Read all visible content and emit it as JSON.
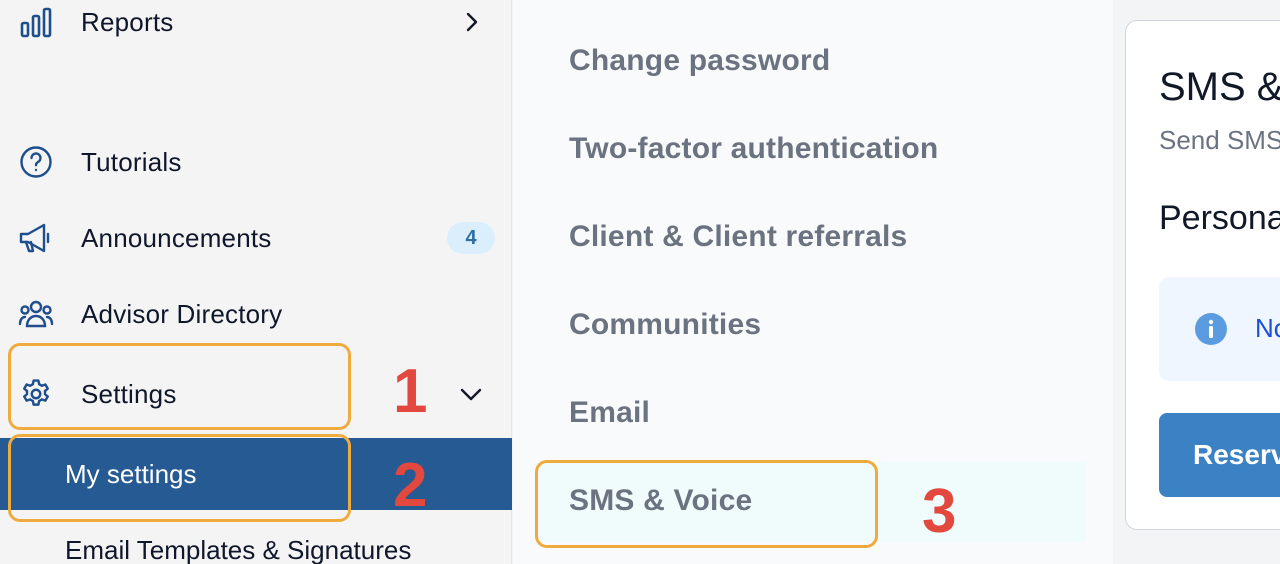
{
  "sidebar": {
    "items": [
      {
        "label": "Reports",
        "icon": "bar-chart-icon"
      },
      {
        "label": "Tutorials",
        "icon": "question-circle-icon"
      },
      {
        "label": "Announcements",
        "icon": "megaphone-icon",
        "badge": "4"
      },
      {
        "label": "Advisor Directory",
        "icon": "users-icon"
      },
      {
        "label": "Settings",
        "icon": "gear-icon"
      }
    ],
    "sub_items": [
      {
        "label": "My settings",
        "active": true
      },
      {
        "label": "Email Templates & Signatures"
      }
    ]
  },
  "settings_menu": {
    "items": [
      {
        "label": "Change password"
      },
      {
        "label": "Two-factor authentication"
      },
      {
        "label": "Client & Client referrals"
      },
      {
        "label": "Communities"
      },
      {
        "label": "Email"
      },
      {
        "label": "SMS & Voice",
        "active": true
      }
    ]
  },
  "card": {
    "title": "SMS &",
    "subtitle": "Send SMS",
    "section_title": "Persona",
    "notice_text": "No",
    "button_label": "Reserv"
  },
  "annotations": [
    "1",
    "2",
    "3"
  ],
  "colors": {
    "active_sidebar": "#265a92",
    "highlight_border": "#f0ab3e",
    "annotation_text": "#e2483d",
    "badge_bg": "#dbeefb",
    "primary_button": "#3b82c4"
  }
}
